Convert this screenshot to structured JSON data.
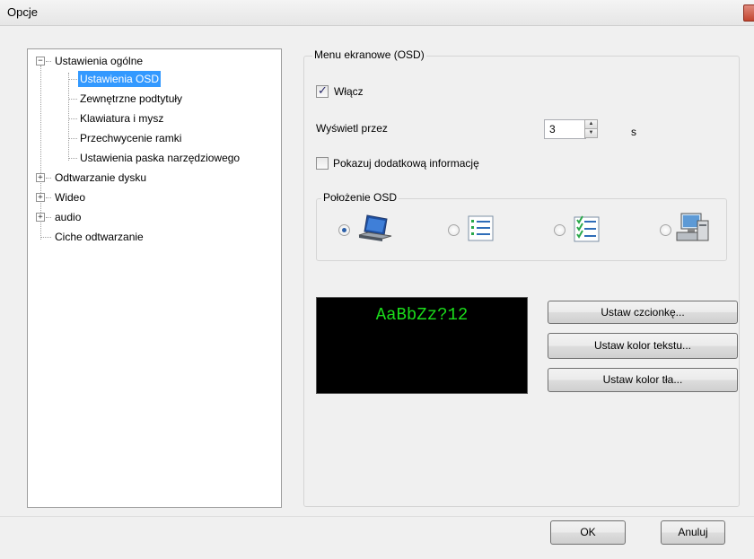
{
  "window": {
    "title": "Opcje"
  },
  "tree": {
    "items": [
      {
        "label": "Ustawienia ogólne",
        "expander": "−"
      },
      {
        "label": "Ustawienia OSD"
      },
      {
        "label": "Zewnętrzne podtytuły"
      },
      {
        "label": "Klawiatura i mysz"
      },
      {
        "label": "Przechwycenie ramki"
      },
      {
        "label": "Ustawienia paska narzędziowego"
      },
      {
        "label": "Odtwarzanie dysku",
        "expander": "+"
      },
      {
        "label": "Wideo",
        "expander": "+"
      },
      {
        "label": "audio",
        "expander": "+"
      },
      {
        "label": "Ciche odtwarzanie"
      }
    ]
  },
  "osd": {
    "group_title": "Menu ekranowe (OSD)",
    "enable_label": "Włącz",
    "enable_checked": true,
    "duration_label": "Wyświetl przez",
    "duration_value": "3",
    "duration_unit": "s",
    "extra_info_label": "Pokazuj dodatkową informację",
    "extra_info_checked": false,
    "position": {
      "title": "Położenie OSD",
      "options": [
        {
          "icon": "laptop-icon",
          "selected": true
        },
        {
          "icon": "list-icon",
          "selected": false
        },
        {
          "icon": "checklist-icon",
          "selected": false
        },
        {
          "icon": "monitor-icon",
          "selected": false
        }
      ]
    },
    "preview_text": "AaBbZz?12",
    "preview_text_color": "#1bdc1b",
    "preview_bg_color": "#000000",
    "buttons": {
      "font": "Ustaw czcionkę...",
      "text_color": "Ustaw kolor tekstu...",
      "bg_color": "Ustaw kolor tła..."
    }
  },
  "footer": {
    "ok": "OK",
    "cancel": "Anuluj"
  },
  "colors": {
    "selection": "#3399ff",
    "accent": "#2b5fa8"
  }
}
